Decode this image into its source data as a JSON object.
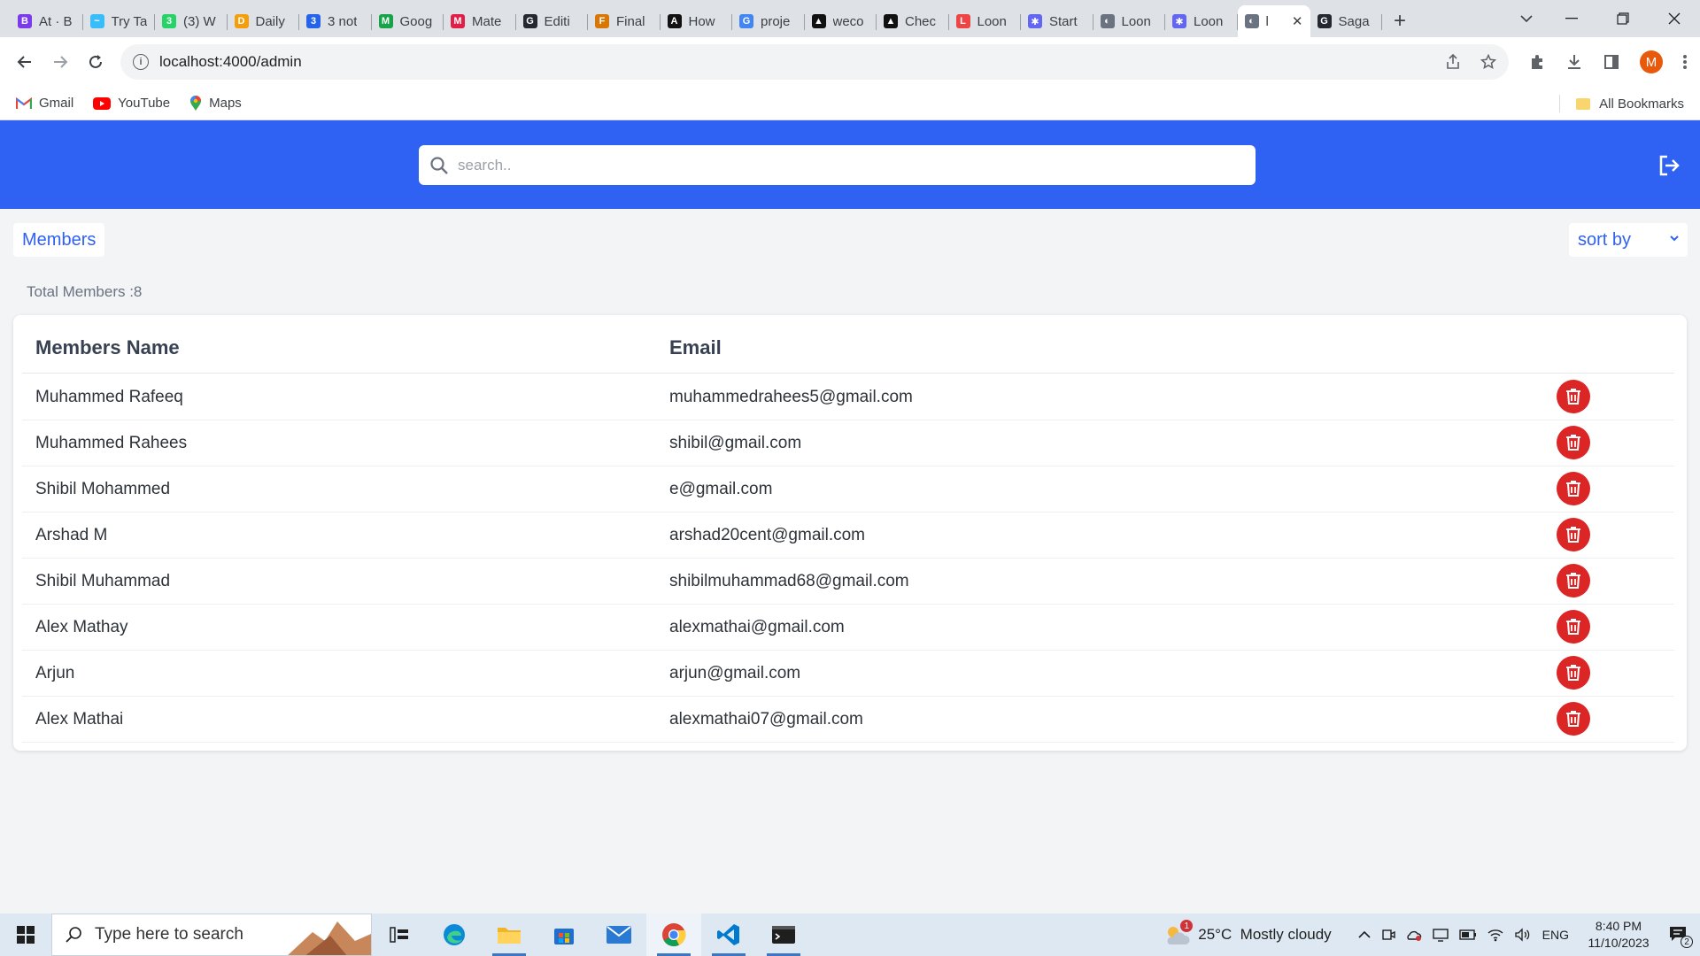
{
  "browser": {
    "tabs": [
      {
        "label": "At · B",
        "fav": "B",
        "color": "#7c3aed"
      },
      {
        "label": "Try Ta",
        "fav": "~",
        "color": "#38bdf8"
      },
      {
        "label": "(3) W",
        "fav": "3",
        "color": "#25d366"
      },
      {
        "label": "Daily",
        "fav": "D",
        "color": "#f59e0b"
      },
      {
        "label": "3 not",
        "fav": "3",
        "color": "#2563eb"
      },
      {
        "label": "Goog",
        "fav": "M",
        "color": "#16a34a"
      },
      {
        "label": "Mate",
        "fav": "M",
        "color": "#e11d48"
      },
      {
        "label": "Editi",
        "fav": "G",
        "color": "#24292f"
      },
      {
        "label": "Final",
        "fav": "F",
        "color": "#d97706"
      },
      {
        "label": "How",
        "fav": "A",
        "color": "#111111"
      },
      {
        "label": "proje",
        "fav": "G",
        "color": "#4285f4"
      },
      {
        "label": "weco",
        "fav": "▲",
        "color": "#111111"
      },
      {
        "label": "Chec",
        "fav": "▲",
        "color": "#111111"
      },
      {
        "label": "Loon",
        "fav": "L",
        "color": "#ef4444"
      },
      {
        "label": "Start",
        "fav": "✱",
        "color": "#6366f1"
      },
      {
        "label": "Loon",
        "fav": "◐",
        "color": "#6b7280"
      },
      {
        "label": "Loon",
        "fav": "✱",
        "color": "#6366f1"
      },
      {
        "label": "l",
        "fav": "◐",
        "color": "#6b7280",
        "active": true
      },
      {
        "label": "Saga",
        "fav": "G",
        "color": "#24292f"
      }
    ],
    "url": "localhost:4000/admin",
    "profile_initial": "M",
    "bookmarks": [
      {
        "label": "Gmail"
      },
      {
        "label": "YouTube"
      },
      {
        "label": "Maps"
      }
    ],
    "all_bookmarks": "All Bookmarks"
  },
  "header": {
    "search_placeholder": "search.."
  },
  "toolbar": {
    "members_label": "Members",
    "sort_label": "sort by"
  },
  "summary": {
    "total_members": "Total Members :8"
  },
  "table": {
    "columns": [
      "Members Name",
      "Email"
    ],
    "rows": [
      {
        "name": "Muhammed Rafeeq",
        "email": "muhammedrahees5@gmail.com"
      },
      {
        "name": "Muhammed Rahees",
        "email": "shibil@gmail.com"
      },
      {
        "name": "Shibil Mohammed",
        "email": "e@gmail.com"
      },
      {
        "name": "Arshad M",
        "email": "arshad20cent@gmail.com"
      },
      {
        "name": "Shibil Muhammad",
        "email": "shibilmuhammad68@gmail.com"
      },
      {
        "name": "Alex Mathay",
        "email": "alexmathai@gmail.com"
      },
      {
        "name": "Arjun",
        "email": "arjun@gmail.com"
      },
      {
        "name": "Alex Mathai",
        "email": "alexmathai07@gmail.com"
      }
    ]
  },
  "taskbar": {
    "search_placeholder": "Type here to search",
    "weather": "25°C  Mostly cloudy",
    "weather_badge": "1",
    "lang": "ENG",
    "time": "8:40 PM",
    "date": "11/10/2023",
    "notif_count": "2"
  },
  "colors": {
    "accent": "#2f62f2",
    "delete": "#dc2626"
  }
}
